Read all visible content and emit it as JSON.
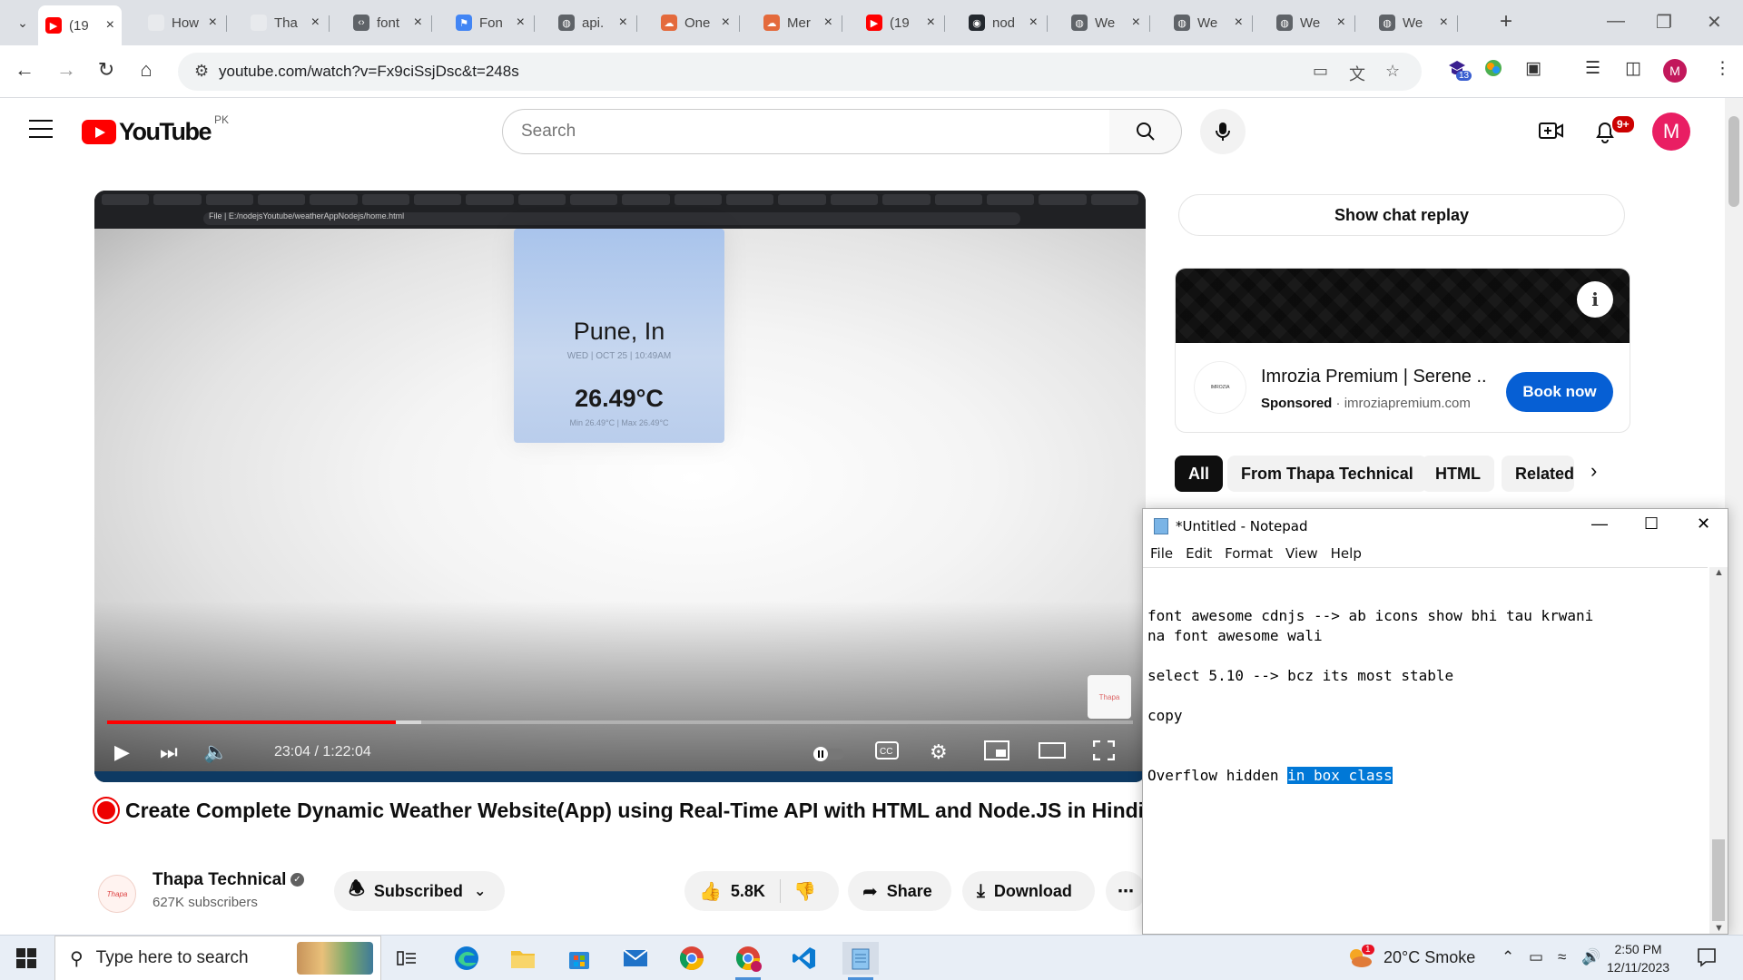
{
  "browser": {
    "tabs": [
      {
        "title": "(19",
        "favicon": "youtube-icon",
        "color": "#ff0000",
        "active": true
      },
      {
        "title": "How",
        "favicon": "page-icon",
        "color": "#e8eaed"
      },
      {
        "title": "Tha",
        "favicon": "page-icon",
        "color": "#e8eaed"
      },
      {
        "title": "font",
        "favicon": "code-icon",
        "color": "#5f6368"
      },
      {
        "title": "Fon",
        "favicon": "flag-icon",
        "color": "#4285f4"
      },
      {
        "title": "api.",
        "favicon": "globe-icon",
        "color": "#5f6368"
      },
      {
        "title": "One",
        "favicon": "cloud-icon",
        "color": "#e46a3c"
      },
      {
        "title": "Mer",
        "favicon": "cloud-icon",
        "color": "#e46a3c"
      },
      {
        "title": "(19",
        "favicon": "youtube-icon",
        "color": "#ff0000"
      },
      {
        "title": "nod",
        "favicon": "github-icon",
        "color": "#24292f"
      },
      {
        "title": "We",
        "favicon": "globe-icon",
        "color": "#5f6368"
      },
      {
        "title": "We",
        "favicon": "globe-icon",
        "color": "#5f6368"
      },
      {
        "title": "We",
        "favicon": "globe-icon",
        "color": "#5f6368"
      },
      {
        "title": "We",
        "favicon": "globe-icon",
        "color": "#5f6368"
      }
    ],
    "url": "youtube.com/watch?v=Fx9ciSsjDsc&t=248s",
    "extension_badge": "13",
    "profile_initial": "M"
  },
  "youtube": {
    "logo_text": "YouTube",
    "country_code": "PK",
    "search_placeholder": "Search",
    "notification_count": "9+",
    "avatar_initial": "M",
    "player": {
      "city": "Pune, In",
      "date": "WED | OCT 25 | 10:49AM",
      "temperature": "26.49°C",
      "minmax": "Min 26.49°C | Max 26.49°C",
      "inner_url": "File | E:/nodejsYoutube/weatherAppNodejs/home.html",
      "time_display": "23:04 / 1:22:04",
      "progress_fraction": 0.2811,
      "buffer_fraction": 0.25
    },
    "video_title": "Create Complete Dynamic Weather Website(App) using Real-Time API with HTML and Node.JS in Hindi",
    "channel": {
      "name": "Thapa Technical",
      "subscribers": "627K subscribers",
      "subscribe_label": "Subscribed"
    },
    "actions": {
      "likes": "5.8K",
      "share": "Share",
      "download": "Download"
    },
    "sidebar": {
      "chat_replay": "Show chat replay",
      "ad": {
        "title": "Imrozia Premium | Serene ...",
        "sponsored": "Sponsored",
        "domain": "imroziapremium.com",
        "button": "Book now"
      },
      "chips": [
        "All",
        "From Thapa Technical",
        "HTML",
        "Related"
      ]
    }
  },
  "notepad": {
    "title": "*Untitled - Notepad",
    "menu": [
      "File",
      "Edit",
      "Format",
      "View",
      "Help"
    ],
    "lines": [
      "font awesome cdnjs --> ab icons show bhi tau krwani",
      "na font awesome wali",
      "",
      "select 5.10 --> bcz its most stable",
      "",
      "copy",
      "",
      ""
    ],
    "last_line_plain": "Overflow hidden ",
    "last_line_selected": "in box class"
  },
  "taskbar": {
    "search_placeholder": "Type here to search",
    "weather": "20°C  Smoke",
    "weather_badge": "1",
    "time": "2:50 PM",
    "date": "12/11/2023"
  }
}
